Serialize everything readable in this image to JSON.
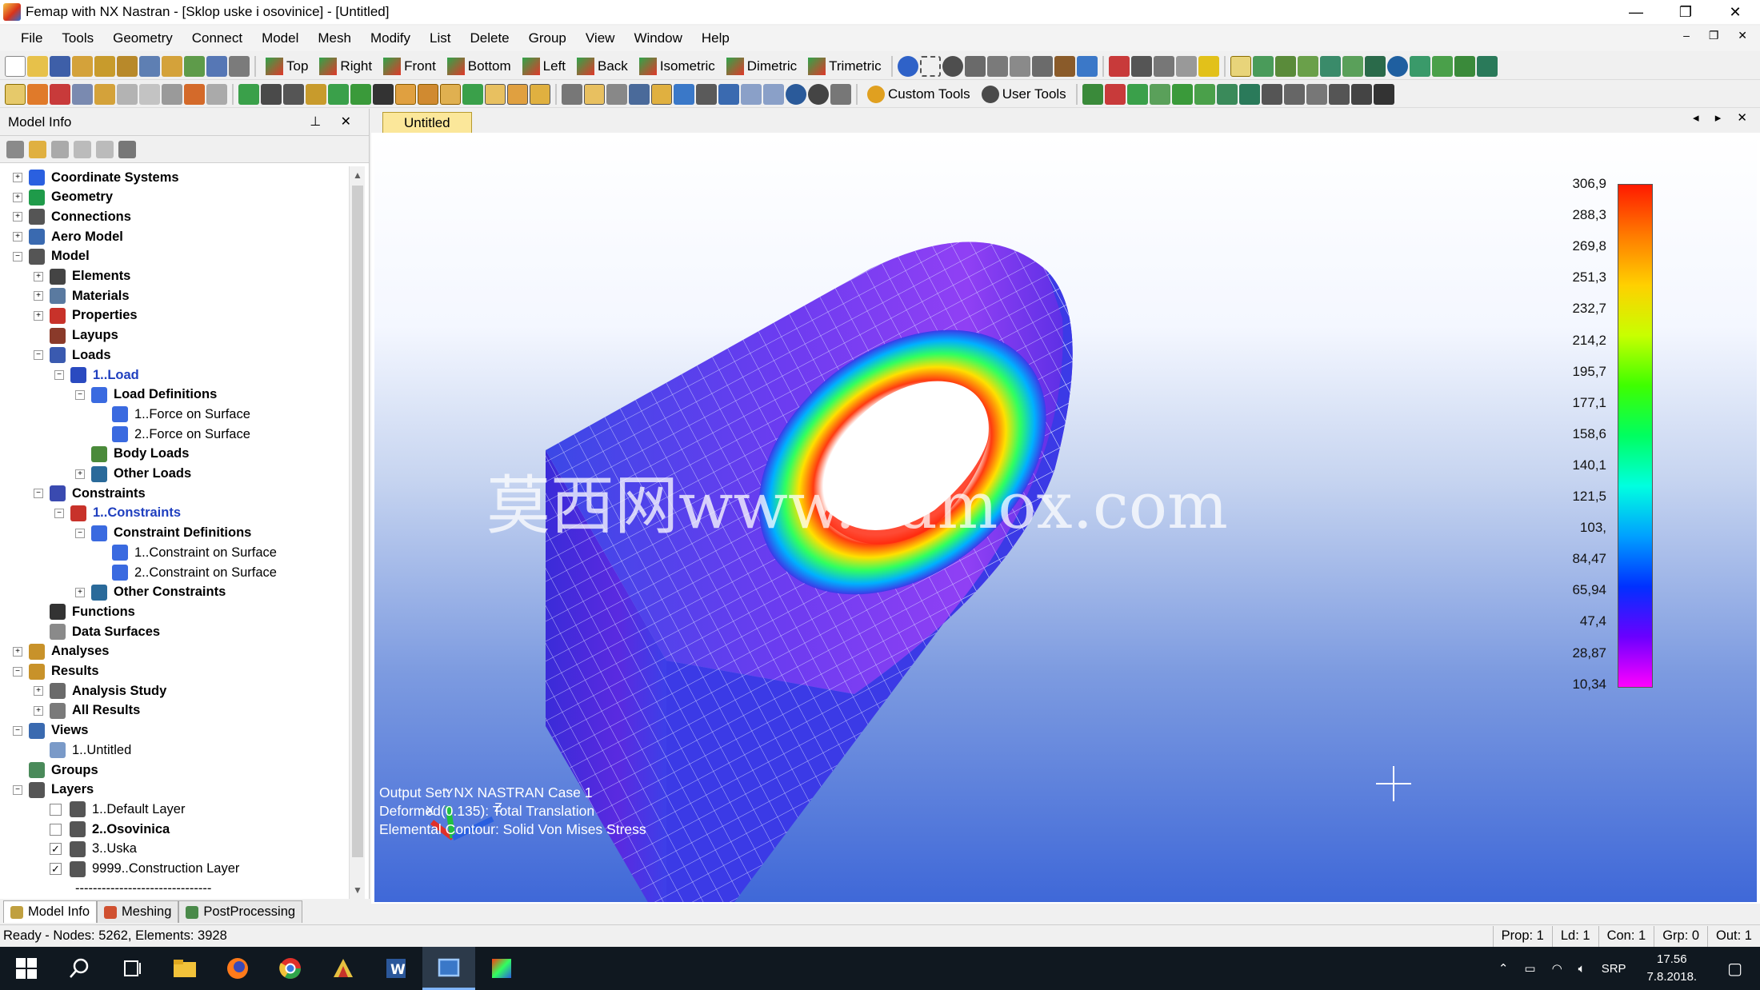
{
  "window": {
    "title": "Femap with NX Nastran - [Sklop uske i osovinice] - [Untitled]",
    "controls": [
      "—",
      "❐",
      "✕"
    ]
  },
  "menu": [
    "File",
    "Tools",
    "Geometry",
    "Connect",
    "Model",
    "Mesh",
    "Modify",
    "List",
    "Delete",
    "Group",
    "View",
    "Window",
    "Help"
  ],
  "mdi_controls": "– ❐ ✕",
  "view_buttons": [
    "Top",
    "Right",
    "Front",
    "Bottom",
    "Left",
    "Back",
    "Isometric",
    "Dimetric",
    "Trimetric"
  ],
  "tool_menus": [
    "Custom Tools",
    "User Tools"
  ],
  "left_panel": {
    "title": "Model Info",
    "controls": "⊥ ✕",
    "tree": [
      {
        "label": "Coordinate Systems",
        "level": 0,
        "exp": "+",
        "bold": true,
        "icon": "coordinate-icon"
      },
      {
        "label": "Geometry",
        "level": 0,
        "exp": "+",
        "bold": true,
        "icon": "geometry-icon"
      },
      {
        "label": "Connections",
        "level": 0,
        "exp": "+",
        "bold": true,
        "icon": "connection-icon"
      },
      {
        "label": "Aero Model",
        "level": 0,
        "exp": "+",
        "bold": true,
        "icon": "aero-icon"
      },
      {
        "label": "Model",
        "level": 0,
        "exp": "−",
        "bold": true,
        "icon": "model-icon"
      },
      {
        "label": "Elements",
        "level": 1,
        "exp": "+",
        "bold": true,
        "icon": "elements-icon"
      },
      {
        "label": "Materials",
        "level": 1,
        "exp": "+",
        "bold": true,
        "icon": "materials-icon"
      },
      {
        "label": "Properties",
        "level": 1,
        "exp": "+",
        "bold": true,
        "icon": "properties-icon"
      },
      {
        "label": "Layups",
        "level": 1,
        "exp": "",
        "bold": true,
        "icon": "layups-icon"
      },
      {
        "label": "Loads",
        "level": 1,
        "exp": "−",
        "bold": true,
        "icon": "loads-icon"
      },
      {
        "label": "1..Load",
        "level": 2,
        "exp": "−",
        "bold": true,
        "blue": true,
        "icon": "load-set-icon"
      },
      {
        "label": "Load Definitions",
        "level": 3,
        "exp": "−",
        "bold": true,
        "icon": "load-definitions-icon"
      },
      {
        "label": "1..Force on Surface",
        "level": 4,
        "exp": "",
        "bold": false,
        "icon": "force-icon"
      },
      {
        "label": "2..Force on Surface",
        "level": 4,
        "exp": "",
        "bold": false,
        "icon": "force-icon"
      },
      {
        "label": "Body Loads",
        "level": 3,
        "exp": "",
        "bold": true,
        "icon": "body-loads-icon"
      },
      {
        "label": "Other Loads",
        "level": 3,
        "exp": "+",
        "bold": true,
        "icon": "other-loads-icon"
      },
      {
        "label": "Constraints",
        "level": 1,
        "exp": "−",
        "bold": true,
        "icon": "constraints-icon"
      },
      {
        "label": "1..Constraints",
        "level": 2,
        "exp": "−",
        "bold": true,
        "blue": true,
        "icon": "constraint-set-icon"
      },
      {
        "label": "Constraint Definitions",
        "level": 3,
        "exp": "−",
        "bold": true,
        "icon": "constraint-definitions-icon"
      },
      {
        "label": "1..Constraint on Surface",
        "level": 4,
        "exp": "",
        "bold": false,
        "icon": "constraint-icon"
      },
      {
        "label": "2..Constraint on Surface",
        "level": 4,
        "exp": "",
        "bold": false,
        "icon": "constraint-icon"
      },
      {
        "label": "Other Constraints",
        "level": 3,
        "exp": "+",
        "bold": true,
        "icon": "other-constraints-icon"
      },
      {
        "label": "Functions",
        "level": 1,
        "exp": "",
        "bold": true,
        "icon": "function-xy-icon"
      },
      {
        "label": "Data Surfaces",
        "level": 1,
        "exp": "",
        "bold": true,
        "icon": "data-surfaces-icon"
      },
      {
        "label": "Analyses",
        "level": 0,
        "exp": "+",
        "bold": true,
        "icon": "analyses-icon"
      },
      {
        "label": "Results",
        "level": 0,
        "exp": "−",
        "bold": true,
        "icon": "results-icon"
      },
      {
        "label": "Analysis Study",
        "level": 1,
        "exp": "+",
        "bold": true,
        "icon": "analysis-study-icon"
      },
      {
        "label": "All Results",
        "level": 1,
        "exp": "+",
        "bold": true,
        "icon": "all-results-icon"
      },
      {
        "label": "Views",
        "level": 0,
        "exp": "−",
        "bold": true,
        "icon": "views-icon"
      },
      {
        "label": "1..Untitled",
        "level": 1,
        "exp": "",
        "bold": false,
        "icon": "view-icon"
      },
      {
        "label": "Groups",
        "level": 0,
        "exp": "",
        "bold": true,
        "icon": "groups-icon"
      },
      {
        "label": "Layers",
        "level": 0,
        "exp": "−",
        "bold": true,
        "icon": "layers-icon"
      },
      {
        "label": "1..Default Layer",
        "level": 1,
        "exp": "",
        "bold": false,
        "icon": "layer-icon",
        "check": ""
      },
      {
        "label": "2..Osovinica",
        "level": 1,
        "exp": "",
        "bold": true,
        "icon": "layer-icon",
        "check": ""
      },
      {
        "label": "3..Uska",
        "level": 1,
        "exp": "",
        "bold": false,
        "icon": "layer-icon",
        "check": "✓"
      },
      {
        "label": "9999..Construction Layer",
        "level": 1,
        "exp": "",
        "bold": false,
        "icon": "layer-icon",
        "check": "✓"
      }
    ],
    "tree_tail": "-------------------------------",
    "tabs": [
      "Model Info",
      "Meshing",
      "PostProcessing"
    ]
  },
  "viewport": {
    "tab": "Untitled",
    "controls": "◂ ▸ ✕",
    "watermark": "莫西网www.3dmox.com",
    "legend_values": [
      "306,9",
      "288,3",
      "269,8",
      "251,3",
      "232,7",
      "214,2",
      "195,7",
      "177,1",
      "158,6",
      "140,1",
      "121,5",
      "103,",
      "84,47",
      "65,94",
      "47,4",
      "28,87",
      "10,34"
    ],
    "output_lines": [
      "Output Set: NX NASTRAN Case 1",
      "Deformed(0.135): Total Translation",
      "Elemental Contour: Solid Von Mises Stress"
    ],
    "triad": {
      "x": "X",
      "y": "Y",
      "z": "Z"
    }
  },
  "status": {
    "left": "Ready - Nodes: 5262,  Elements: 3928",
    "cells": [
      "Prop: 1",
      "Ld: 1",
      "Con: 1",
      "Grp: 0",
      "Out: 1"
    ]
  },
  "taskbar": {
    "apps": [
      "start-icon",
      "search-icon",
      "task-view-icon",
      "file-explorer-icon",
      "firefox-icon",
      "chrome-icon",
      "femap-icon",
      "word-icon",
      "window-app-icon",
      "color-app-icon"
    ],
    "lang": "SRP",
    "time": "17.56",
    "date": "7.8.2018."
  },
  "colors": {
    "accent": "#1f3fbf",
    "tab": "#fbe79a",
    "taskbar": "#101820"
  }
}
